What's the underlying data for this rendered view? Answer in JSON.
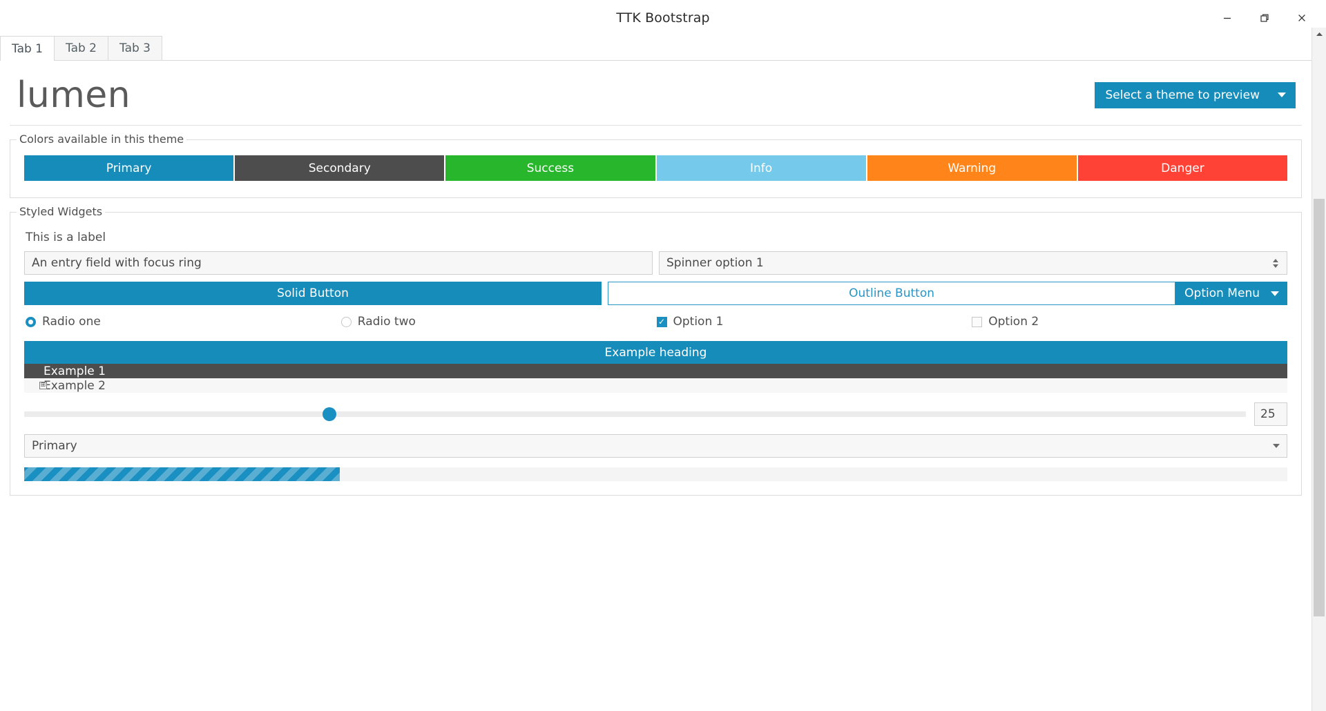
{
  "window": {
    "title": "TTK Bootstrap",
    "controls": [
      {
        "name": "minimize-button",
        "glyph": "minimize-icon"
      },
      {
        "name": "maximize-button",
        "glyph": "restore-icon"
      },
      {
        "name": "close-button",
        "glyph": "close-icon"
      }
    ]
  },
  "tabs": [
    {
      "label": "Tab 1",
      "active": true
    },
    {
      "label": "Tab 2",
      "active": false
    },
    {
      "label": "Tab 3",
      "active": false
    }
  ],
  "hero": {
    "theme_name": "lumen",
    "theme_select_label": "Select a theme to preview",
    "theme_select_bg": "#158cba"
  },
  "colors_frame": {
    "title": "Colors available in this theme",
    "swatches": [
      {
        "label": "Primary",
        "color": "#158cba"
      },
      {
        "label": "Secondary",
        "color": "#4d4d4d"
      },
      {
        "label": "Success",
        "color": "#28b62c"
      },
      {
        "label": "Info",
        "color": "#75caeb"
      },
      {
        "label": "Warning",
        "color": "#ff851b"
      },
      {
        "label": "Danger",
        "color": "#ff4136"
      }
    ]
  },
  "widgets_frame": {
    "title": "Styled Widgets",
    "label": "This is a label",
    "entry_value": "An entry field with focus ring",
    "spinner_value": "Spinner option 1",
    "solid_button": "Solid Button",
    "outline_button": "Outline Button",
    "option_menu": "Option Menu",
    "radios": [
      {
        "label": "Radio one",
        "selected": true
      },
      {
        "label": "Radio two",
        "selected": false
      }
    ],
    "checks": [
      {
        "label": "Option 1",
        "checked": true,
        "mark": "✓"
      },
      {
        "label": "Option 2",
        "checked": false,
        "mark": ""
      }
    ],
    "tree": {
      "heading": "Example heading",
      "rows": [
        {
          "label": "Example 1",
          "selected": true,
          "expander": ""
        },
        {
          "label": "Example 2",
          "selected": false,
          "expander": "⊞"
        }
      ]
    },
    "scale": {
      "value": "25",
      "percent": 25,
      "min": 0,
      "max": 100
    },
    "combobox_value": "Primary",
    "progress_percent": 25
  },
  "scrollbar": {
    "up_arrow": "scroll-up-icon",
    "thumb_name": "scrollbar-thumb"
  }
}
